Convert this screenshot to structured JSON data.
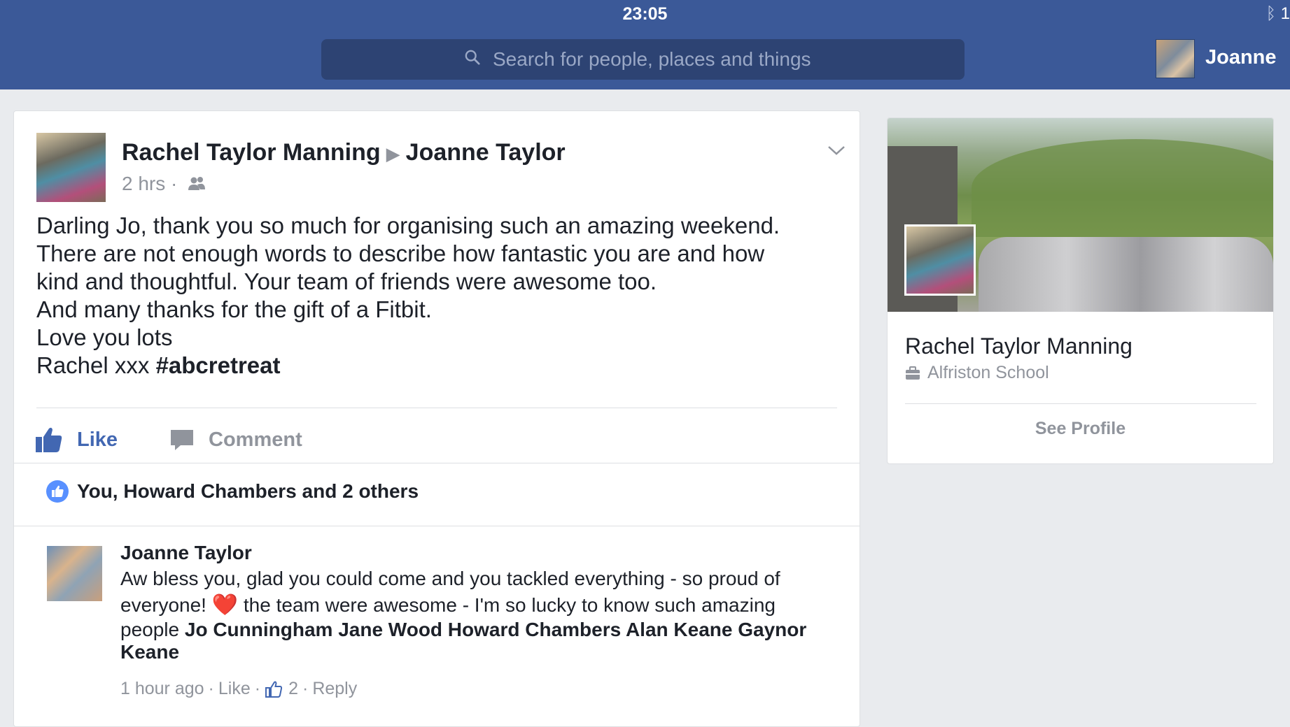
{
  "status_bar": {
    "time": "23:05",
    "bluetooth": "ᛒ",
    "battery": "1"
  },
  "header": {
    "search_placeholder": "Search for people, places and things",
    "user_name": "Joanne"
  },
  "post": {
    "author": "Rachel Taylor Manning",
    "arrow": "▶",
    "target": "Joanne Taylor",
    "time": "2 hrs",
    "audience_sep": "·",
    "audience_icon": "friends-icon",
    "body_lines": [
      "Darling Jo, thank you so much for organising such an amazing weekend.",
      "There are not enough words to describe how fantastic you are and how",
      "kind and thoughtful. Your team of friends were awesome too.",
      "And many thanks for the gift of a Fitbit.",
      "Love you lots"
    ],
    "body_last_prefix": "Rachel xxx ",
    "hashtag": "#abcretreat",
    "like_label": "Like",
    "comment_label": "Comment",
    "likes_summary": "You, Howard Chambers and 2 others"
  },
  "comment": {
    "author": "Joanne Taylor",
    "line1": "Aw bless you, glad you could come and you tackled everything - so proud of",
    "line2_a": "everyone! ",
    "heart": "❤️",
    "line2_b": " the team were awesome - I'm so lucky to know such amazing",
    "line3_prefix": "people ",
    "tags": "Jo Cunningham Jane Wood Howard Chambers Alan Keane Gaynor",
    "tags_tail": "Keane",
    "time": "1 hour ago",
    "sep": "·",
    "like_label": "Like",
    "like_count": "2",
    "reply_label": "Reply"
  },
  "profile_card": {
    "name": "Rachel Taylor Manning",
    "work": "Alfriston School",
    "work_icon": "briefcase-icon",
    "see_profile": "See Profile"
  },
  "colors": {
    "brand_blue": "#3b5998",
    "link_blue": "#4267b2",
    "gray_text": "#90949c"
  }
}
